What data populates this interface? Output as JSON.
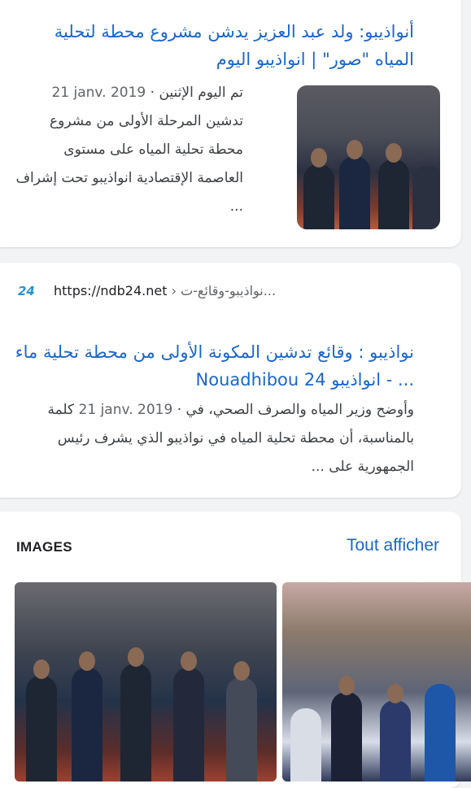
{
  "results": [
    {
      "title": "أنواذيبو: ولد عبد العزيز يدشن مشروع محطة لتحلية المياه \"صور\" | انواذيبو اليوم",
      "date": "21 janv. 2019",
      "snippet": "تم اليوم الإثنين · 21 janv. 2019 تدشين المرحلة الأولى من مشروع محطة تحلية المياه على مستوى العاصمة الإقتصادية انواذيبو تحت إشراف ...",
      "snippet_lead": "تم اليوم الإثنين · ",
      "snippet_body": "تدشين المرحلة الأولى من مشروع محطة تحلية المياه على مستوى العاصمة الإقتصادية انواذيبو تحت إشراف ..."
    },
    {
      "site_icon": "24",
      "url": "https://ndb24.net",
      "url_sep": " › ",
      "url_path": "نواذيبو-وقائع-ت...",
      "title": "نواذيبو : وقائع تدشين المكونة الأولى من محطة تحلية ماء ... - انواذيبو Nouadhibou 24",
      "date": "21 janv. 2019",
      "snippet_lead": "وأوضح وزير المياه والصرف الصحي، في · ",
      "snippet_body": "كلمة بالمناسبة، أن محطة تحلية المياه في نواذيبو الذي يشرف رئيس الجمهورية على ..."
    }
  ],
  "images_section": {
    "heading": "IMAGES",
    "show_all": "Tout afficher"
  }
}
